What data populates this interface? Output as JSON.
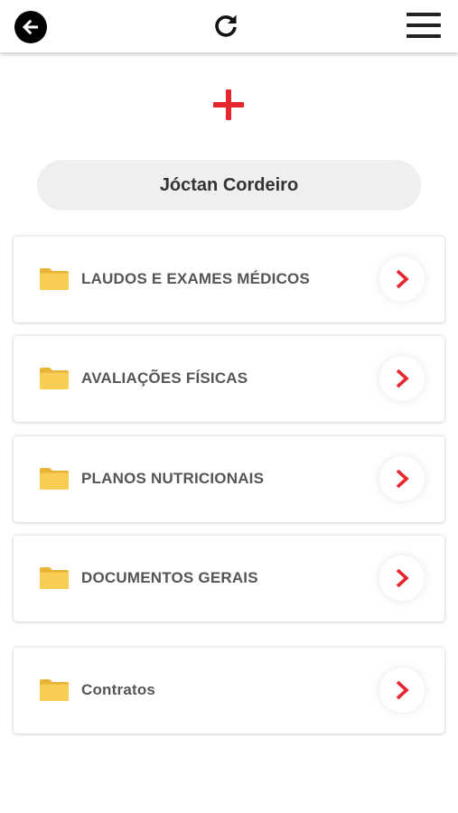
{
  "header": {
    "back_icon": "arrow-left-circle-icon",
    "refresh_icon": "refresh-icon",
    "menu_icon": "hamburger-menu-icon"
  },
  "add_icon": "plus-icon",
  "profile": {
    "name": "Jóctan Cordeiro"
  },
  "folders": [
    {
      "label": "LAUDOS E EXAMES MÉDICOS",
      "icon": "folder-icon"
    },
    {
      "label": "AVALIAÇÕES FÍSICAS",
      "icon": "folder-icon"
    },
    {
      "label": "PLANOS NUTRICIONAIS",
      "icon": "folder-icon"
    },
    {
      "label": "DOCUMENTOS GERAIS",
      "icon": "folder-icon"
    },
    {
      "label": "Contratos",
      "icon": "folder-icon"
    }
  ],
  "colors": {
    "accent": "#e8262d",
    "folder": "#f6c94a",
    "text": "#555555",
    "pill_bg": "#efefef"
  }
}
